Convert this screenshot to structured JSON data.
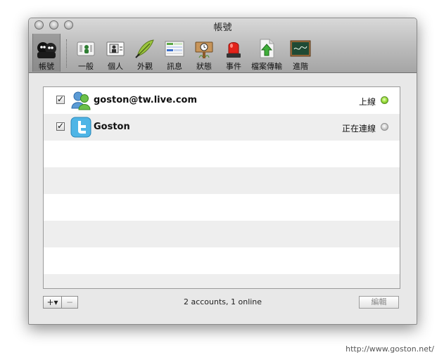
{
  "window": {
    "title": "帳號"
  },
  "toolbar": {
    "items": [
      {
        "label": "帳號",
        "icon": "accounts-icon"
      },
      {
        "label": "一般",
        "icon": "general-icon"
      },
      {
        "label": "個人",
        "icon": "personal-icon"
      },
      {
        "label": "外觀",
        "icon": "appearance-icon"
      },
      {
        "label": "訊息",
        "icon": "messages-icon"
      },
      {
        "label": "狀態",
        "icon": "status-icon"
      },
      {
        "label": "事件",
        "icon": "events-icon"
      },
      {
        "label": "檔案傳輸",
        "icon": "file-transfer-icon"
      },
      {
        "label": "進階",
        "icon": "advanced-icon"
      }
    ]
  },
  "accounts": [
    {
      "name": "goston@tw.live.com",
      "status": "上線",
      "enabled": true,
      "service_icon": "msn-icon",
      "status_color": "#7ed321"
    },
    {
      "name": "Goston",
      "status": "正在連線",
      "enabled": true,
      "service_icon": "twitter-icon",
      "status_color": "#b0b0b0"
    }
  ],
  "footer": {
    "add_label": "+▾",
    "remove_label": "−",
    "summary": "2 accounts, 1 online",
    "edit_label": "編輯"
  },
  "watermark": "http://www.goston.net/"
}
